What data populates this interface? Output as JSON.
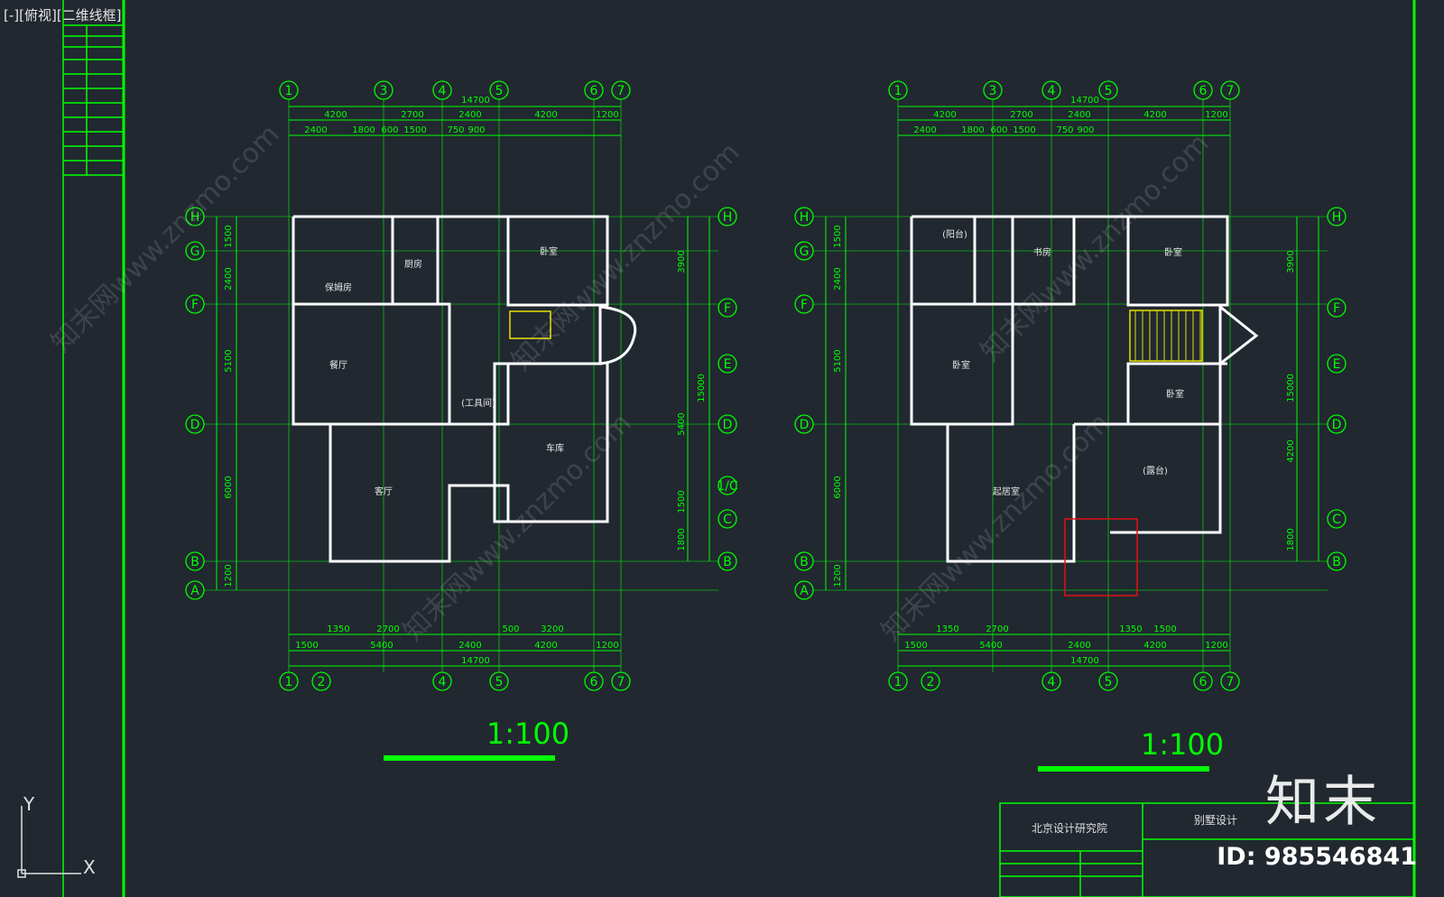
{
  "viewport": {
    "label": "[-][俯视][二维线框]",
    "background": "#212830",
    "line_color": "#00ff00"
  },
  "plans": [
    {
      "name": "ground-floor",
      "scale": "1:100",
      "grid_top": [
        "1",
        "3",
        "4",
        "5",
        "6",
        "7"
      ],
      "grid_bottom": [
        "1",
        "2",
        "4",
        "5",
        "6",
        "7"
      ],
      "grid_left": [
        "H",
        "G",
        "F",
        "D",
        "B",
        "A"
      ],
      "grid_right": [
        "H",
        "F",
        "E",
        "D",
        "1/C",
        "C",
        "B"
      ],
      "dim_top_total": "14700",
      "dim_top_row1": [
        "4200",
        "2700",
        "2400",
        "4200",
        "1200"
      ],
      "dim_top_row2": [
        "2400",
        "1800",
        "600",
        "1500",
        "750",
        "900"
      ],
      "dim_bottom_row1": [
        "1350",
        "2700",
        "500",
        "3200"
      ],
      "dim_bottom_row2": [
        "1500",
        "5400",
        "2400",
        "4200",
        "1200"
      ],
      "dim_bottom_total": "14700",
      "dim_left": [
        "1500",
        "2400",
        "5100",
        "6000",
        "1200"
      ],
      "dim_right": [
        "3900",
        "15000",
        "5400",
        "1500",
        "1800"
      ],
      "rooms": [
        "卧室",
        "厨房",
        "餐厅",
        "客厅",
        "车库",
        "(工具间)",
        "保姆房"
      ]
    },
    {
      "name": "upper-floor",
      "scale": "1:100",
      "grid_top": [
        "1",
        "3",
        "4",
        "5",
        "6",
        "7"
      ],
      "grid_bottom": [
        "1",
        "2",
        "4",
        "5",
        "6",
        "7"
      ],
      "grid_left": [
        "H",
        "G",
        "F",
        "D",
        "B",
        "A"
      ],
      "grid_right": [
        "H",
        "F",
        "E",
        "D",
        "C",
        "B"
      ],
      "dim_top_total": "14700",
      "dim_top_row1": [
        "4200",
        "2700",
        "2400",
        "4200",
        "1200"
      ],
      "dim_top_row2": [
        "2400",
        "1800",
        "600",
        "1500",
        "750",
        "900"
      ],
      "dim_bottom_row1": [
        "1350",
        "2700",
        "1350",
        "1500"
      ],
      "dim_bottom_row2": [
        "1500",
        "5400",
        "2400",
        "4200",
        "1200"
      ],
      "dim_bottom_total": "14700",
      "dim_left": [
        "1500",
        "2400",
        "5100",
        "6000",
        "1200"
      ],
      "dim_right": [
        "3900",
        "15000",
        "4200",
        "1800"
      ],
      "rooms": [
        "(阳台)",
        "书房",
        "卧室",
        "卧室",
        "卧室",
        "起居室",
        "(露台)"
      ]
    }
  ],
  "title_block": {
    "company": "北京设计研究院",
    "project": "别墅设计"
  },
  "watermark": {
    "brand": "知末",
    "id_text": "ID: 985546841",
    "site": "知末网www.znzmo.com"
  },
  "ucs": {
    "x": "X",
    "y": "Y"
  }
}
